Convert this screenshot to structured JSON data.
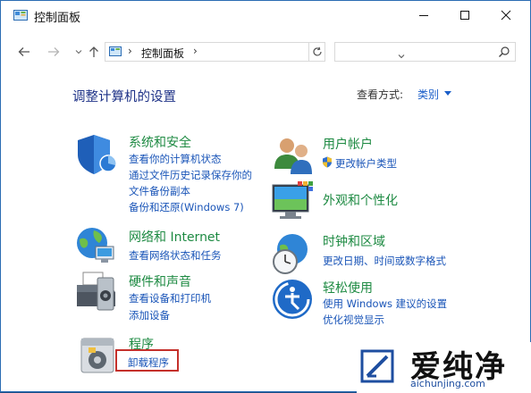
{
  "window": {
    "title": "控制面板"
  },
  "address": {
    "crumb": "控制面板",
    "sep": "›",
    "search_placeholder": ""
  },
  "main": {
    "heading": "调整计算机的设置",
    "view_by_label": "查看方式:",
    "view_by_value": "类别"
  },
  "categories": {
    "system": {
      "title": "系统和安全",
      "links": [
        "查看你的计算机状态",
        "通过文件历史记录保存你的",
        "文件备份副本",
        "备份和还原(Windows 7)"
      ]
    },
    "network": {
      "title": "网络和 Internet",
      "links": [
        "查看网络状态和任务"
      ]
    },
    "hardware": {
      "title": "硬件和声音",
      "links": [
        "查看设备和打印机",
        "添加设备"
      ]
    },
    "programs": {
      "title": "程序",
      "links": [
        "卸载程序"
      ]
    },
    "users": {
      "title": "用户帐户",
      "links": [
        "更改帐户类型"
      ]
    },
    "appearance": {
      "title": "外观和个性化",
      "links": []
    },
    "clock": {
      "title": "时钟和区域",
      "links": [
        "更改日期、时间或数字格式"
      ]
    },
    "ease": {
      "title": "轻松使用",
      "links": [
        "使用 Windows 建议的设置",
        "优化视觉显示"
      ]
    }
  },
  "watermark": {
    "brand": "爱纯净",
    "site": "aichunjing.com"
  },
  "colors": {
    "title_green": "#1d8a42",
    "link_blue": "#1a55b8",
    "heading_blue": "#1e3287",
    "highlight_red": "#c4302b"
  }
}
